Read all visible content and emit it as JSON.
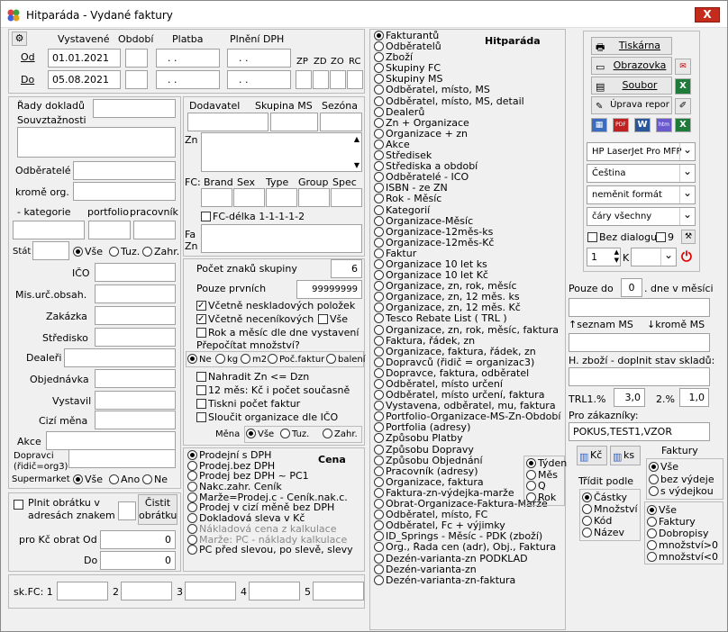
{
  "window": {
    "title": "Hitparáda - Vydané faktury",
    "close": "X"
  },
  "dates": {
    "col_issued": "Vystavené",
    "col_period": "Období",
    "col_payment": "Platba",
    "col_vat": "Plnění DPH",
    "from_label": "Od",
    "to_label": "Do",
    "from_value": "01.01.2021",
    "to_value": "05.08.2021",
    "payment_mask": " .  .",
    "vat_mask": " .  .",
    "zp": "ZP",
    "zd": "ZD",
    "zo": "ZO",
    "rc": "RC"
  },
  "left": {
    "rady": "Řady dokladů",
    "souvztaznosti": "Souvztažnosti",
    "odberatele": "Odběratelé",
    "krome": "kromě org.",
    "kategorie": "- kategorie",
    "portfolio": "portfolio",
    "pracovnik": "pracovník",
    "stat": "Stát",
    "vse": "Vše",
    "tuz": "Tuz.",
    "zahr": "Zahr.",
    "ico": "IČO",
    "mis": "Mis.urč.obsah.",
    "zakazka": "Zakázka",
    "stredisko": "Středisko",
    "dealer": "Dealeři",
    "objednavka": "Objednávka",
    "vystavil": "Vystavil",
    "cizi": "Cizí měna",
    "akce": "Akce",
    "dopravci": "Dopravci",
    "dopravci2": "(řidič=org3)",
    "supermarket": "Supermarket",
    "ano": "Ano",
    "ne": "Ne",
    "plnit": "Plnit obrátku v adresách znakem",
    "cistit": "Čistit obrátku",
    "prokc": "pro Kč obrat Od",
    "do": "Do",
    "obrat_od": "0",
    "obrat_do": "0"
  },
  "mid": {
    "dodavatel": "Dodavatel",
    "skupina": "Skupina MS",
    "sezona": "Sezóna",
    "zn": "Zn",
    "fc": "FC:",
    "brand": "Brand",
    "sex": "Sex",
    "type": "Type",
    "group": "Group",
    "spec": "Spec",
    "fcdelka": "FC-délka 1-1-1-1-2",
    "fa": "Fa",
    "zn2": "Zn",
    "pocet_znaku": "Počet znaků skupiny",
    "pocet_value": "6",
    "pouze_prvnich": "Pouze prvních",
    "pouze_value": "99999999",
    "vcetne_nesk": "Včetně neskladových položek",
    "vcetne_necen": "Včetně neceníkových",
    "vse": "Vše",
    "rok_mesic": "Rok a měsíc dle dne vystavení",
    "prepocitat": "Přepočítat množství?",
    "ne": "Ne",
    "kg": "kg",
    "m2": "m2",
    "pocfaktur": "Poč.faktur",
    "baleni": "balení",
    "nahradit": "Nahradit Zn <= Dzn",
    "dvanact": "12 měs: Kč i počet současně",
    "tisknipocet": "Tiskni počet faktur",
    "sloucit": "Sloučit organizace dle IČO",
    "mena": "Měna",
    "mvse": "Vše",
    "mtuz": "Tuz.",
    "mzahr": "Zahr."
  },
  "cena": {
    "title": "Cena",
    "options": [
      "Prodejní s DPH",
      "Prodej.bez DPH",
      "Prodej bez DPH ~ PC1",
      "Nakc.zahr. Ceník",
      "Marže=Prodej.c - Ceník.nak.c.",
      "Prodej v cizí měně bez DPH",
      "Dokladová sleva v Kč",
      "Nákladová cena z kalkulace",
      "Marže: PC - náklady kalkulace",
      "PC před slevou, po slevě, slevy"
    ]
  },
  "skfc": {
    "label": "sk.FC: 1",
    "n2": "2",
    "n3": "3",
    "n4": "4",
    "n5": "5"
  },
  "hitparada": {
    "title": "Hitparáda",
    "items": [
      "Fakturantů",
      "Odběratelů",
      "Zboží",
      "Skupiny FC",
      "Skupiny MS",
      "Odběratel, místo, MS",
      "Odběratel, místo, MS, detail",
      "Dealerů",
      "Zn + Organizace",
      "Organizace + zn",
      "Akce",
      "Středisek",
      "Střediska a období",
      "Odběratelé - IČO",
      "ISBN - ze ZN",
      "Rok - Měsíc",
      "Kategorií",
      "Organizace-Měsíc",
      "Organizace-12měs-ks",
      "Organizace-12měs-Kč",
      "Faktur",
      "Organizace 10 let ks",
      "Organizace 10 let Kč",
      "Organizace, zn, rok, měsíc",
      "Organizace, zn, 12 měs. ks",
      "Organizace, zn, 12 měs. Kč",
      "Tesco Rebate List ( TRL )",
      "Organizace, zn, rok, měsíc, faktura",
      "Faktura, řádek, zn",
      "Organizace, faktura, řádek, zn",
      "Dopravců (řidič = organizac3)",
      "Dopravce, faktura, odběratel",
      "Odběratel, místo určení",
      "Odběratel, místo určení, faktura",
      "Vystavena, odběratel, mu, faktura",
      "Portfolio-Organizace-MS-Zn-Období",
      "Portfolia (adresy)",
      "Způsobu Platby",
      "Způsobu Dopravy",
      "Způsobu Objednání",
      "Pracovník (adresy)",
      "Organizace, faktura",
      "Faktura-zn-výdejka-marže",
      "Obrat-Organizace-Faktura-Marže",
      "Odběratel, místo, FC",
      "Odběratel, Fc + výjimky",
      "ID_Springs - Měsíc - PDK (zboží)",
      "Org., Řada cen (adr), Obj., Faktura",
      "Dezén-varianta-zn PODKLAD",
      "Dezén-varianta-zn",
      "Dezén-varianta-zn-faktura"
    ]
  },
  "period": {
    "items": [
      "Týden",
      "Měs",
      "Q",
      "Rok"
    ]
  },
  "right": {
    "tiskarna": "Tiskárna",
    "obrazovka": "Obrazovka",
    "soubor": "Soubor",
    "uprava": "Úprava repor",
    "printer": "HP LaserJet Pro MFP",
    "lang": "Čeština",
    "format": "neměnit formát",
    "lines": "čáry všechny",
    "bezdialogu": "Bez dialogu",
    "nine": "9",
    "copies": "1",
    "k": "K",
    "pouzedo": "Pouze do",
    "pouzedo_val": "0",
    "dnevmesici": ". dne v měsíci",
    "seznamms": "↑seznam MS",
    "kromems": "↓kromě MS",
    "hzbozi": "H. zboží - doplnit stav skladů:",
    "trl": "TRL1.%",
    "trl_val": "3,0",
    "two": "2.%",
    "two_val": "1,0",
    "prozak": "Pro zákazníky:",
    "prozak_val": "POKUS,TEST1,VZOR",
    "kc": "Kč",
    "ks": "ks",
    "faktury": "Faktury",
    "trid": "Třídit podle",
    "trid_items": [
      "Částky",
      "Množství",
      "Kód",
      "Název"
    ],
    "fak1": [
      "Vše",
      "bez výdeje",
      "s výdejkou"
    ],
    "fak2": [
      "Vše",
      "Faktury",
      "Dobropisy",
      "množství>0",
      "množství<0"
    ]
  }
}
